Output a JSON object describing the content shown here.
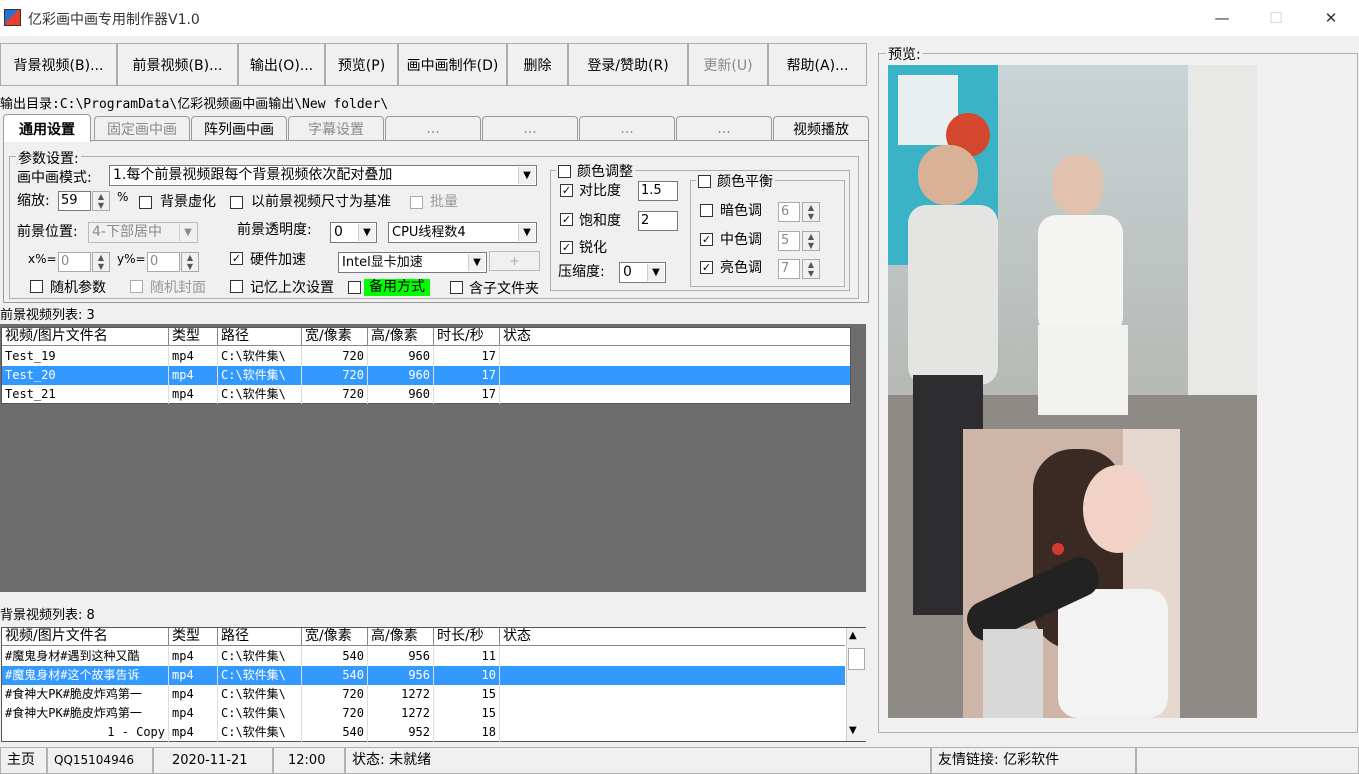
{
  "window": {
    "title": "亿彩画中画专用制作器V1.0",
    "minimize": "—",
    "maximize": "☐",
    "close": "✕"
  },
  "toolbar": {
    "bg_video": "背景视频(B)...",
    "fg_video": "前景视频(B)...",
    "output": "输出(O)...",
    "preview": "预览(P)",
    "pip_make": "画中画制作(D)",
    "delete": "删除",
    "login": "登录/赞助(R)",
    "update": "更新(U)",
    "help": "帮助(A)..."
  },
  "output_dir": "输出目录:C:\\ProgramData\\亿彩视频画中画输出\\New folder\\",
  "tabs": [
    "通用设置",
    "固定画中画",
    "阵列画中画",
    "字幕设置",
    "...",
    "...",
    "...",
    "...",
    "视频播放"
  ],
  "params": {
    "group_label": "参数设置:",
    "mode_label": "画中画模式:",
    "mode_value": "1.每个前景视频跟每个背景视频依次配对叠加",
    "scale_label": "缩放:",
    "scale_value": "59",
    "percent": "%",
    "bg_blur": "背景虚化",
    "fg_size_base": "以前景视频尺寸为基准",
    "batch": "批量",
    "fg_pos_label": "前景位置:",
    "fg_pos_value": "4-下部居中",
    "fg_alpha_label": "前景透明度:",
    "fg_alpha_value": "0",
    "cpu_threads": "CPU线程数4",
    "x_label": "x%=",
    "x_value": "0",
    "y_label": "y%=",
    "y_value": "0",
    "hw_accel": "硬件加速",
    "gpu_value": "Intel显卡加速",
    "plus": "+",
    "random_params": "随机参数",
    "random_cover": "随机封面",
    "remember": "记忆上次设置",
    "backup_mode": "备用方式",
    "subfolder": "含子文件夹",
    "color_adjust": "颜色调整",
    "contrast": "对比度",
    "contrast_value": "1.5",
    "saturation": "饱和度",
    "saturation_value": "2",
    "sharpen": "锐化",
    "compress_label": "压缩度:",
    "compress_value": "0",
    "color_balance": "颜色平衡",
    "dark_tone": "暗色调",
    "dark_value": "6",
    "mid_tone": "中色调",
    "mid_value": "5",
    "light_tone": "亮色调",
    "light_value": "7"
  },
  "fg_list": {
    "label": "前景视频列表: 3",
    "columns": [
      "视频/图片文件名",
      "类型",
      "路径",
      "宽/像素",
      "高/像素",
      "时长/秒",
      "状态"
    ],
    "rows": [
      [
        "Test_19",
        "mp4",
        "C:\\软件集\\",
        "720",
        "960",
        "17",
        ""
      ],
      [
        "Test_20",
        "mp4",
        "C:\\软件集\\",
        "720",
        "960",
        "17",
        ""
      ],
      [
        "Test_21",
        "mp4",
        "C:\\软件集\\",
        "720",
        "960",
        "17",
        ""
      ]
    ],
    "selected_index": 1
  },
  "bg_list": {
    "label": "背景视频列表: 8",
    "columns": [
      "视频/图片文件名",
      "类型",
      "路径",
      "宽/像素",
      "高/像素",
      "时长/秒",
      "状态"
    ],
    "rows": [
      [
        "#魔鬼身材#遇到这种又酷",
        "mp4",
        "C:\\软件集\\",
        "540",
        "956",
        "11",
        ""
      ],
      [
        "#魔鬼身材#这个故事告诉",
        "mp4",
        "C:\\软件集\\",
        "540",
        "956",
        "10",
        ""
      ],
      [
        "#食神大PK#脆皮炸鸡第一",
        "mp4",
        "C:\\软件集\\",
        "720",
        "1272",
        "15",
        ""
      ],
      [
        "#食神大PK#脆皮炸鸡第一",
        "mp4",
        "C:\\软件集\\",
        "720",
        "1272",
        "15",
        ""
      ],
      [
        "1 - Copy",
        "mp4",
        "C:\\软件集\\",
        "540",
        "952",
        "18",
        ""
      ]
    ],
    "selected_index": 1
  },
  "preview": {
    "label": "预览:"
  },
  "statusbar": {
    "home": "主页",
    "qq": "QQ15104946",
    "date": "2020-11-21",
    "time": "12:00",
    "status": "状态: 未就绪",
    "links": "友情链接: 亿彩软件"
  },
  "colors": {
    "selection": "#3399ff",
    "backup_mode_bg": "#00ff00"
  }
}
